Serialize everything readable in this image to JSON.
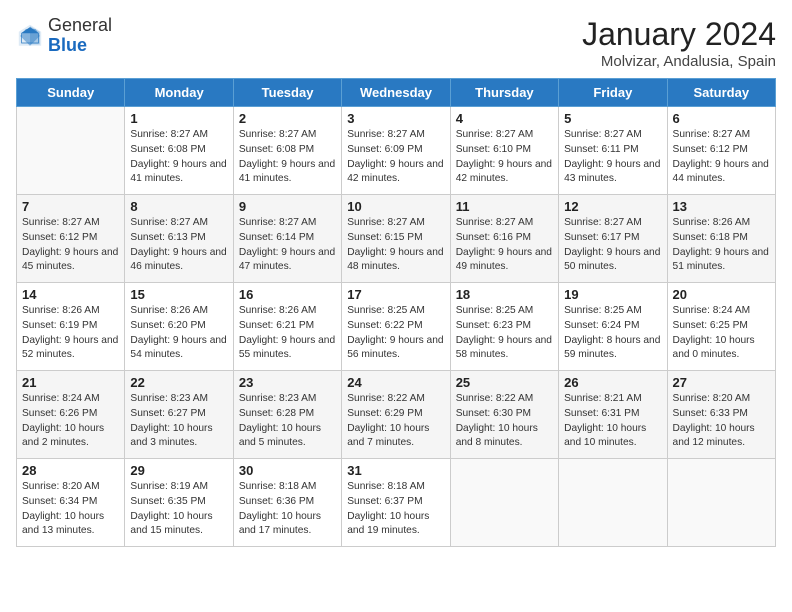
{
  "header": {
    "logo_general": "General",
    "logo_blue": "Blue",
    "month_year": "January 2024",
    "location": "Molvizar, Andalusia, Spain"
  },
  "days_of_week": [
    "Sunday",
    "Monday",
    "Tuesday",
    "Wednesday",
    "Thursday",
    "Friday",
    "Saturday"
  ],
  "weeks": [
    [
      {
        "day": "",
        "sunrise": "",
        "sunset": "",
        "daylight": ""
      },
      {
        "day": "1",
        "sunrise": "Sunrise: 8:27 AM",
        "sunset": "Sunset: 6:08 PM",
        "daylight": "Daylight: 9 hours and 41 minutes."
      },
      {
        "day": "2",
        "sunrise": "Sunrise: 8:27 AM",
        "sunset": "Sunset: 6:08 PM",
        "daylight": "Daylight: 9 hours and 41 minutes."
      },
      {
        "day": "3",
        "sunrise": "Sunrise: 8:27 AM",
        "sunset": "Sunset: 6:09 PM",
        "daylight": "Daylight: 9 hours and 42 minutes."
      },
      {
        "day": "4",
        "sunrise": "Sunrise: 8:27 AM",
        "sunset": "Sunset: 6:10 PM",
        "daylight": "Daylight: 9 hours and 42 minutes."
      },
      {
        "day": "5",
        "sunrise": "Sunrise: 8:27 AM",
        "sunset": "Sunset: 6:11 PM",
        "daylight": "Daylight: 9 hours and 43 minutes."
      },
      {
        "day": "6",
        "sunrise": "Sunrise: 8:27 AM",
        "sunset": "Sunset: 6:12 PM",
        "daylight": "Daylight: 9 hours and 44 minutes."
      }
    ],
    [
      {
        "day": "7",
        "sunrise": "Sunrise: 8:27 AM",
        "sunset": "Sunset: 6:12 PM",
        "daylight": "Daylight: 9 hours and 45 minutes."
      },
      {
        "day": "8",
        "sunrise": "Sunrise: 8:27 AM",
        "sunset": "Sunset: 6:13 PM",
        "daylight": "Daylight: 9 hours and 46 minutes."
      },
      {
        "day": "9",
        "sunrise": "Sunrise: 8:27 AM",
        "sunset": "Sunset: 6:14 PM",
        "daylight": "Daylight: 9 hours and 47 minutes."
      },
      {
        "day": "10",
        "sunrise": "Sunrise: 8:27 AM",
        "sunset": "Sunset: 6:15 PM",
        "daylight": "Daylight: 9 hours and 48 minutes."
      },
      {
        "day": "11",
        "sunrise": "Sunrise: 8:27 AM",
        "sunset": "Sunset: 6:16 PM",
        "daylight": "Daylight: 9 hours and 49 minutes."
      },
      {
        "day": "12",
        "sunrise": "Sunrise: 8:27 AM",
        "sunset": "Sunset: 6:17 PM",
        "daylight": "Daylight: 9 hours and 50 minutes."
      },
      {
        "day": "13",
        "sunrise": "Sunrise: 8:26 AM",
        "sunset": "Sunset: 6:18 PM",
        "daylight": "Daylight: 9 hours and 51 minutes."
      }
    ],
    [
      {
        "day": "14",
        "sunrise": "Sunrise: 8:26 AM",
        "sunset": "Sunset: 6:19 PM",
        "daylight": "Daylight: 9 hours and 52 minutes."
      },
      {
        "day": "15",
        "sunrise": "Sunrise: 8:26 AM",
        "sunset": "Sunset: 6:20 PM",
        "daylight": "Daylight: 9 hours and 54 minutes."
      },
      {
        "day": "16",
        "sunrise": "Sunrise: 8:26 AM",
        "sunset": "Sunset: 6:21 PM",
        "daylight": "Daylight: 9 hours and 55 minutes."
      },
      {
        "day": "17",
        "sunrise": "Sunrise: 8:25 AM",
        "sunset": "Sunset: 6:22 PM",
        "daylight": "Daylight: 9 hours and 56 minutes."
      },
      {
        "day": "18",
        "sunrise": "Sunrise: 8:25 AM",
        "sunset": "Sunset: 6:23 PM",
        "daylight": "Daylight: 9 hours and 58 minutes."
      },
      {
        "day": "19",
        "sunrise": "Sunrise: 8:25 AM",
        "sunset": "Sunset: 6:24 PM",
        "daylight": "Daylight: 8 hours and 59 minutes."
      },
      {
        "day": "20",
        "sunrise": "Sunrise: 8:24 AM",
        "sunset": "Sunset: 6:25 PM",
        "daylight": "Daylight: 10 hours and 0 minutes."
      }
    ],
    [
      {
        "day": "21",
        "sunrise": "Sunrise: 8:24 AM",
        "sunset": "Sunset: 6:26 PM",
        "daylight": "Daylight: 10 hours and 2 minutes."
      },
      {
        "day": "22",
        "sunrise": "Sunrise: 8:23 AM",
        "sunset": "Sunset: 6:27 PM",
        "daylight": "Daylight: 10 hours and 3 minutes."
      },
      {
        "day": "23",
        "sunrise": "Sunrise: 8:23 AM",
        "sunset": "Sunset: 6:28 PM",
        "daylight": "Daylight: 10 hours and 5 minutes."
      },
      {
        "day": "24",
        "sunrise": "Sunrise: 8:22 AM",
        "sunset": "Sunset: 6:29 PM",
        "daylight": "Daylight: 10 hours and 7 minutes."
      },
      {
        "day": "25",
        "sunrise": "Sunrise: 8:22 AM",
        "sunset": "Sunset: 6:30 PM",
        "daylight": "Daylight: 10 hours and 8 minutes."
      },
      {
        "day": "26",
        "sunrise": "Sunrise: 8:21 AM",
        "sunset": "Sunset: 6:31 PM",
        "daylight": "Daylight: 10 hours and 10 minutes."
      },
      {
        "day": "27",
        "sunrise": "Sunrise: 8:20 AM",
        "sunset": "Sunset: 6:33 PM",
        "daylight": "Daylight: 10 hours and 12 minutes."
      }
    ],
    [
      {
        "day": "28",
        "sunrise": "Sunrise: 8:20 AM",
        "sunset": "Sunset: 6:34 PM",
        "daylight": "Daylight: 10 hours and 13 minutes."
      },
      {
        "day": "29",
        "sunrise": "Sunrise: 8:19 AM",
        "sunset": "Sunset: 6:35 PM",
        "daylight": "Daylight: 10 hours and 15 minutes."
      },
      {
        "day": "30",
        "sunrise": "Sunrise: 8:18 AM",
        "sunset": "Sunset: 6:36 PM",
        "daylight": "Daylight: 10 hours and 17 minutes."
      },
      {
        "day": "31",
        "sunrise": "Sunrise: 8:18 AM",
        "sunset": "Sunset: 6:37 PM",
        "daylight": "Daylight: 10 hours and 19 minutes."
      },
      {
        "day": "",
        "sunrise": "",
        "sunset": "",
        "daylight": ""
      },
      {
        "day": "",
        "sunrise": "",
        "sunset": "",
        "daylight": ""
      },
      {
        "day": "",
        "sunrise": "",
        "sunset": "",
        "daylight": ""
      }
    ]
  ]
}
